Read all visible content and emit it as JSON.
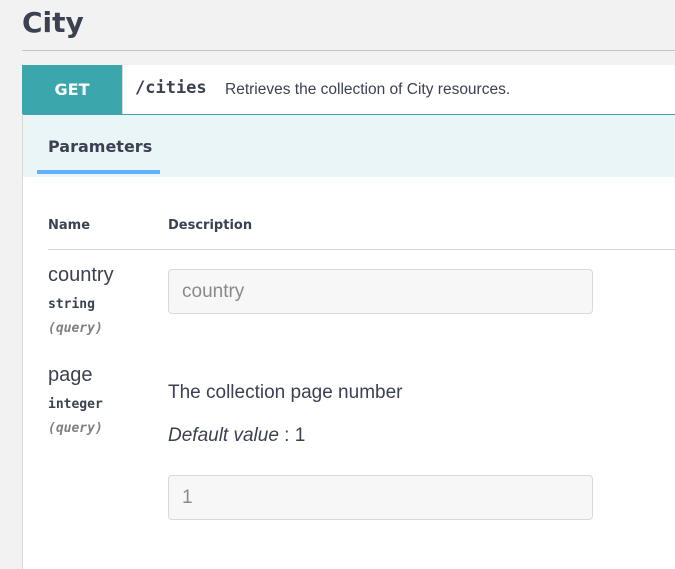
{
  "section": {
    "title": "City"
  },
  "operation": {
    "method": "GET",
    "path": "/cities",
    "summary": "Retrieves the collection of City resources."
  },
  "parameters_tab": {
    "label": "Parameters"
  },
  "table": {
    "headers": {
      "name": "Name",
      "description": "Description"
    },
    "params": [
      {
        "name": "country",
        "type": "string",
        "in": "(query)",
        "placeholder": "country",
        "value": ""
      },
      {
        "name": "page",
        "type": "integer",
        "in": "(query)",
        "description": "The collection page number",
        "default_label": "Default value",
        "default_sep": " : ",
        "default_value": "1",
        "placeholder": "",
        "value": "1"
      }
    ]
  },
  "colors": {
    "get_method": "#3ba7ac",
    "params_bar_bg": "#e9f5f6",
    "tab_underline": "#61affe",
    "text": "#3b4151"
  }
}
